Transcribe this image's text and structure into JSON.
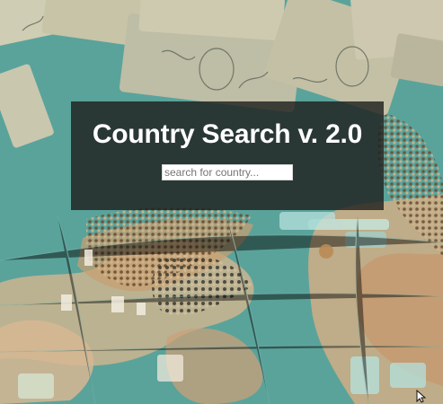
{
  "page": {
    "title": "Country Search v. 2.0"
  },
  "search": {
    "placeholder": "search for country...",
    "value": ""
  },
  "icons": {
    "cursor": "mouse-pointer-icon"
  },
  "colors": {
    "panel_background": "#20211f",
    "title_text": "#ffffff",
    "input_background": "#ffffff",
    "map_ocean": "#5a9d95",
    "map_land": "#d9b28a",
    "banknote": "#c9c1a8"
  }
}
